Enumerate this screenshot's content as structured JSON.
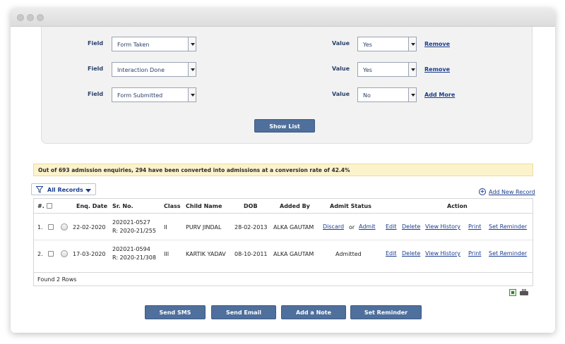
{
  "filters": [
    {
      "field_label": "Field",
      "field_value": "Form Taken",
      "value_label": "Value",
      "value": "Yes",
      "action": "Remove"
    },
    {
      "field_label": "Field",
      "field_value": "Interaction Done",
      "value_label": "Value",
      "value": "Yes",
      "action": "Remove"
    },
    {
      "field_label": "Field",
      "field_value": "Form Submitted",
      "value_label": "Value",
      "value": "No",
      "action": "Add More"
    }
  ],
  "show_list_label": "Show List",
  "banner": "Out of 693 admission enquiries, 294 have been converted into admissions at a conversion rate of 42.4%",
  "records_filter": {
    "label": "All Records",
    "icon": "funnel-icon"
  },
  "add_new_record": "Add New Record",
  "table": {
    "headers": {
      "num": "#.",
      "enq_date": "Enq. Date",
      "sr_no": "Sr. No.",
      "class": "Class",
      "child_name": "Child Name",
      "dob": "DOB",
      "added_by": "Added By",
      "admit_status": "Admit Status",
      "action": "Action"
    },
    "rows": [
      {
        "num": "1.",
        "enq_date": "22-02-2020",
        "sr_line1": "202021-0527",
        "sr_line2": "R: 2020-21/255",
        "class": "II",
        "child_name": "PURV JINDAL",
        "dob": "28-02-2013",
        "added_by": "ALKA GAUTAM",
        "discard": "Discard",
        "or": "or",
        "admit": "Admit"
      },
      {
        "num": "2.",
        "enq_date": "17-03-2020",
        "sr_line1": "202021-0594",
        "sr_line2": "R: 2020-21/308",
        "class": "III",
        "child_name": "KARTIK YADAV",
        "dob": "08-10-2011",
        "added_by": "ALKA GAUTAM",
        "admitted": "Admitted"
      }
    ],
    "actions": {
      "edit": "Edit",
      "delete": "Delete",
      "view_history": "View History",
      "print": "Print",
      "set_reminder": "Set Reminder"
    }
  },
  "footer": "Found 2 Rows",
  "buttons": {
    "send_sms": "Send SMS",
    "send_email": "Send Email",
    "add_note": "Add a Note",
    "set_reminder": "Set Reminder"
  }
}
